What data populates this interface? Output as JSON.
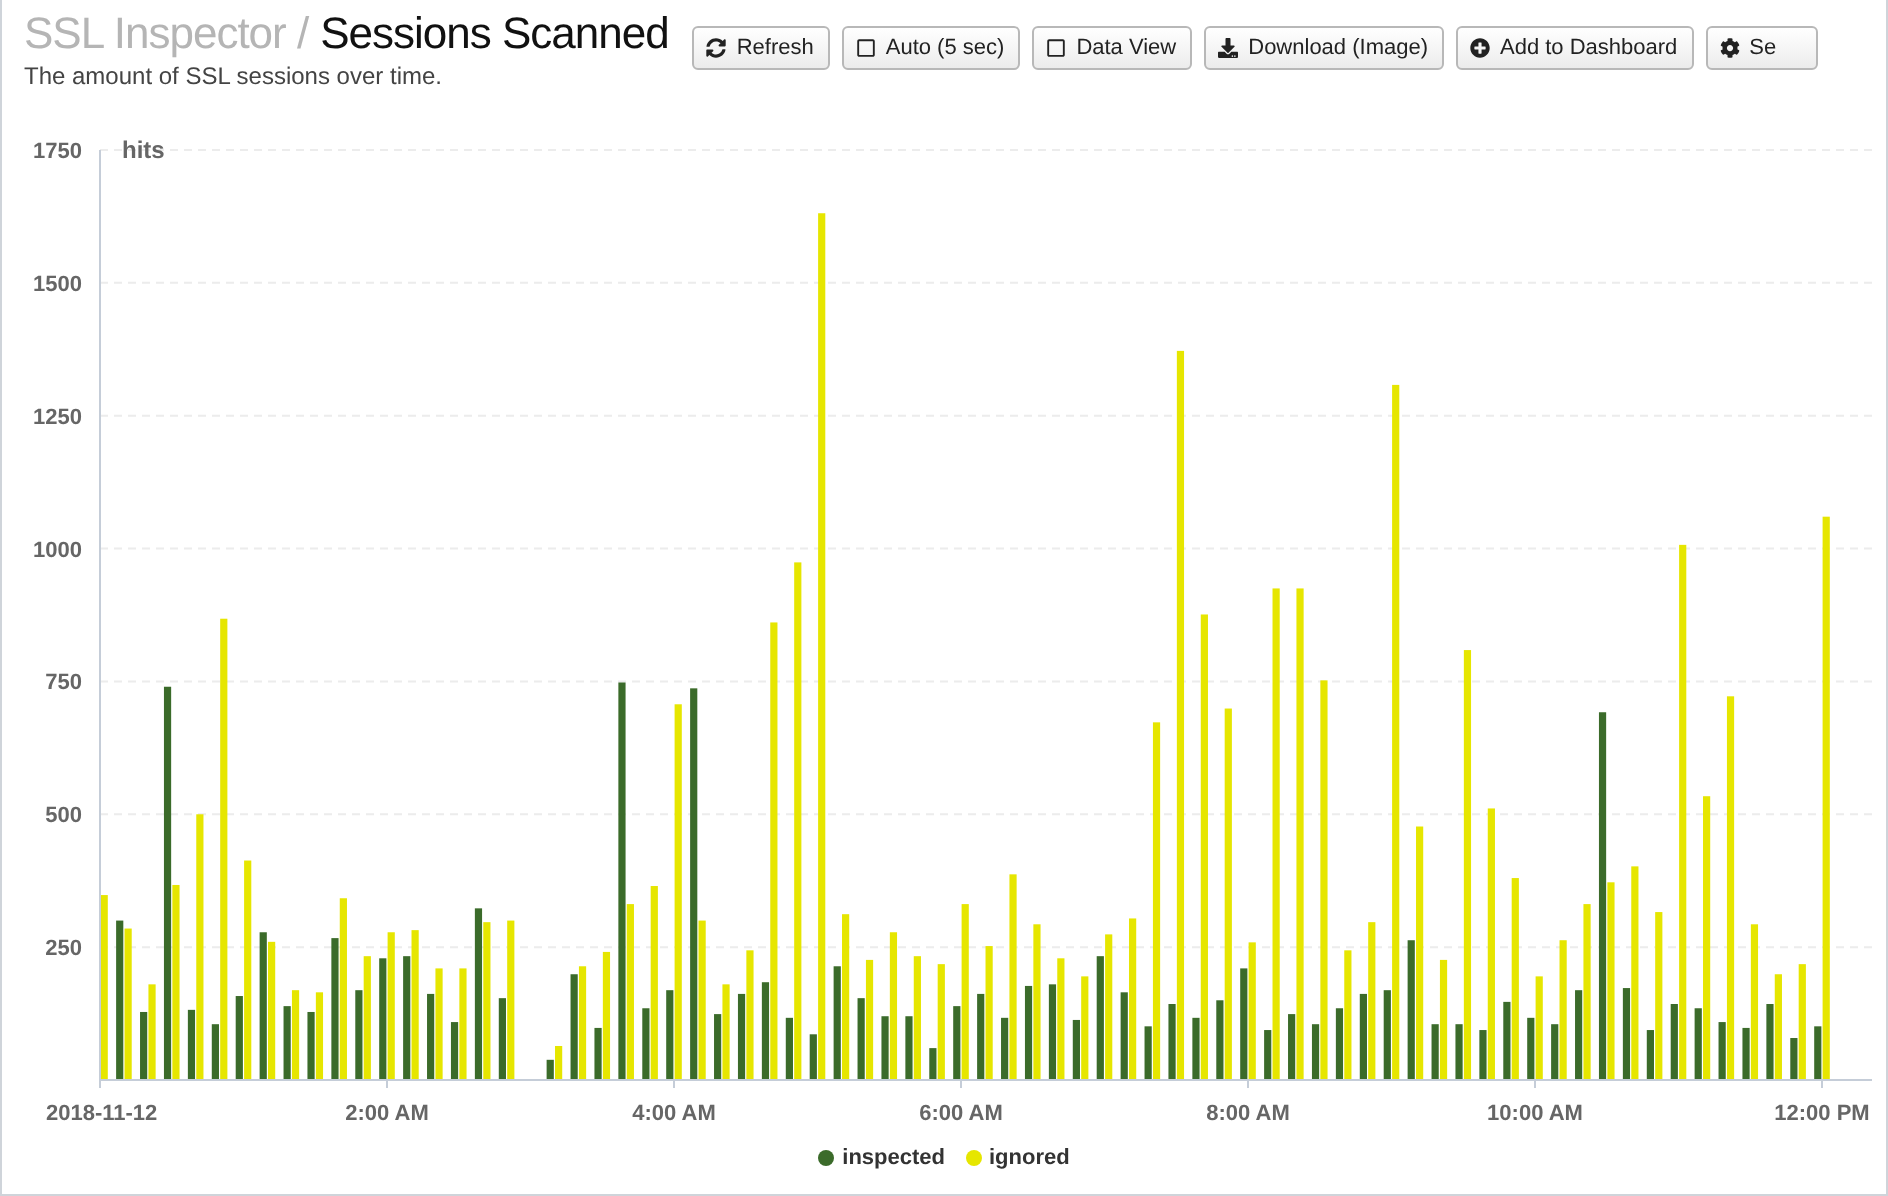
{
  "header": {
    "breadcrumb": "SSL Inspector /",
    "title": "Sessions Scanned",
    "subtitle": "The amount of SSL sessions over time."
  },
  "toolbar": [
    {
      "kind": "refresh",
      "label": "Refresh"
    },
    {
      "kind": "checkbox",
      "label": "Auto (5 sec)",
      "checked": false
    },
    {
      "kind": "checkbox",
      "label": "Data View",
      "checked": false
    },
    {
      "kind": "download",
      "label": "Download (Image)"
    },
    {
      "kind": "add",
      "label": "Add to Dashboard"
    },
    {
      "kind": "settings",
      "label": "Se"
    }
  ],
  "chart": {
    "chart_data": {
      "type": "bar",
      "grid": true,
      "legend": true,
      "ylabel": "hits",
      "xlim": [
        0,
        720
      ],
      "ylim": [
        0,
        1750
      ],
      "yticks": [
        250,
        500,
        750,
        1000,
        1250,
        1500,
        1750
      ],
      "xticks": [
        {
          "value": 0,
          "label": "2018-11-12"
        },
        {
          "value": 120,
          "label": "2:00 AM"
        },
        {
          "value": 240,
          "label": "4:00 AM"
        },
        {
          "value": 360,
          "label": "6:00 AM"
        },
        {
          "value": 480,
          "label": "8:00 AM"
        },
        {
          "value": 600,
          "label": "10:00 AM"
        },
        {
          "value": 720,
          "label": "12:00 PM"
        }
      ],
      "x": [
        0,
        10,
        20,
        30,
        40,
        50,
        60,
        70,
        80,
        90,
        100,
        110,
        120,
        130,
        140,
        150,
        160,
        170,
        180,
        190,
        200,
        210,
        220,
        230,
        240,
        250,
        260,
        270,
        280,
        290,
        300,
        310,
        320,
        330,
        340,
        350,
        360,
        370,
        380,
        390,
        400,
        410,
        420,
        430,
        440,
        450,
        460,
        470,
        480,
        490,
        500,
        510,
        520,
        530,
        540,
        550,
        560,
        570,
        580,
        590,
        600,
        610,
        620,
        630,
        640,
        650,
        660,
        670,
        680,
        690,
        700,
        710,
        720
      ],
      "series": [
        {
          "name": "inspected",
          "color": "#3b6b2a",
          "values": [
            null,
            300,
            128,
            740,
            132,
            105,
            158,
            278,
            139,
            128,
            267,
            169,
            229,
            233,
            162,
            109,
            323,
            154,
            null,
            38,
            199,
            98,
            748,
            135,
            169,
            737,
            124,
            162,
            184,
            117,
            86,
            214,
            154,
            120,
            120,
            60,
            139,
            162,
            117,
            177,
            180,
            113,
            233,
            165,
            101,
            143,
            117,
            150,
            210,
            94,
            124,
            105,
            135,
            162,
            169,
            263,
            105,
            105,
            94,
            147,
            117,
            105,
            169,
            692,
            173,
            94,
            143,
            135,
            109,
            98,
            143,
            79,
            101
          ]
        },
        {
          "name": "ignored",
          "color": "#e6e600",
          "values": [
            348,
            285,
            180,
            367,
            500,
            868,
            413,
            260,
            169,
            165,
            342,
            233,
            278,
            282,
            210,
            210,
            297,
            300,
            null,
            64,
            214,
            241,
            331,
            365,
            707,
            300,
            180,
            244,
            861,
            974,
            1631,
            312,
            226,
            278,
            233,
            218,
            331,
            252,
            387,
            293,
            229,
            195,
            274,
            304,
            673,
            1372,
            876,
            699,
            259,
            925,
            925,
            752,
            244,
            297,
            1308,
            477,
            226,
            809,
            511,
            380,
            195,
            263,
            331,
            372,
            402,
            316,
            1007,
            534,
            722,
            293,
            199,
            218,
            1060
          ]
        }
      ]
    }
  }
}
